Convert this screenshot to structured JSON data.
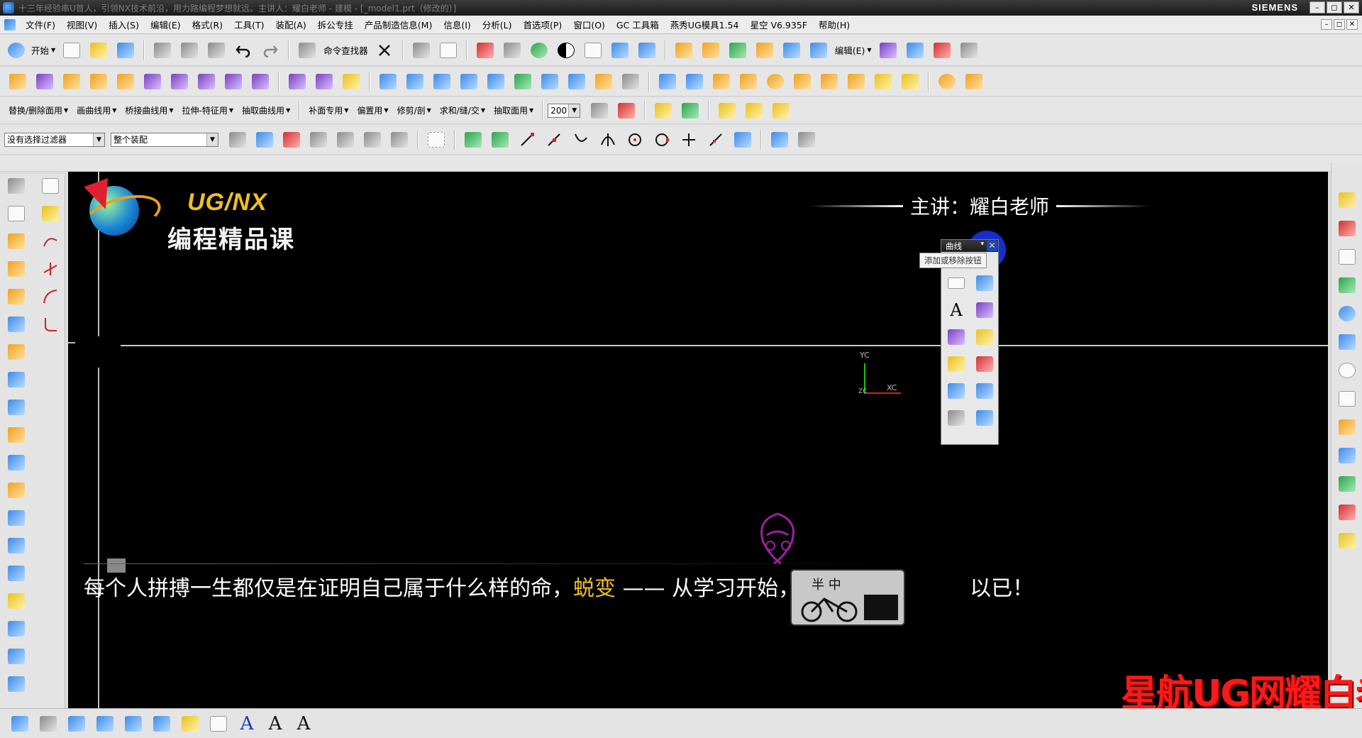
{
  "titlebar": {
    "title": "十三年经验串U首人，引领NX技术前沿，用力路编程梦想就远。主讲人：耀白老师 - 建模 - [_model1.prt（修改的）]",
    "brand": "SIEMENS",
    "btn_min": "–",
    "btn_max": "◻",
    "btn_close": "✕"
  },
  "menubar": {
    "items": [
      "文件(F)",
      "视图(V)",
      "插入(S)",
      "编辑(E)",
      "格式(R)",
      "工具(T)",
      "装配(A)",
      "拆公专挂",
      "产品制造信息(M)",
      "信息(I)",
      "分析(L)",
      "首选项(P)",
      "窗口(O)",
      "GC 工具箱",
      "燕秀UG模具1.54",
      "星空 V6.935F",
      "帮助(H)"
    ],
    "mdi_min": "–",
    "mdi_max": "◻",
    "mdi_close": "✕"
  },
  "toolbar1": {
    "start_label": "开始",
    "cmd_finder_label": "命令查找器",
    "edit_label": "编辑(E)"
  },
  "toolbar3": {
    "items": [
      "替换/删除面用",
      "画曲线用",
      "桥接曲线用",
      "拉伸-特征用",
      "抽取曲线用",
      "补面专用",
      "偏置用",
      "修剪/剖",
      "求和/缝/交",
      "抽取面用"
    ],
    "value": "200"
  },
  "toolbar4": {
    "filter_value": "没有选择过滤器",
    "assembly_value": "整个装配"
  },
  "viewport": {
    "logo_title": "UG/NX",
    "logo_sub": "编程精品课",
    "presenter": "主讲：耀白老师",
    "triad_y": "YC",
    "triad_x": "XC",
    "triad_z": "ZC",
    "subtitle_pre": "每个人拼搏一生都仅是在证明自己属于什么样的命，",
    "subtitle_highlight": "蜕变",
    "subtitle_post": " —— 从学习开始，",
    "subtitle_tail": "以已！",
    "badge_text": "半  中"
  },
  "palette": {
    "title": "曲线",
    "tooltip": "添加或移除按钮",
    "close": "✕",
    "drop": "▾"
  },
  "watermark": "星航UG网耀白老师",
  "colors": {
    "viewport_bg": "#000000",
    "title_gold": "#f0c020",
    "watermark_red": "#ff1818"
  }
}
